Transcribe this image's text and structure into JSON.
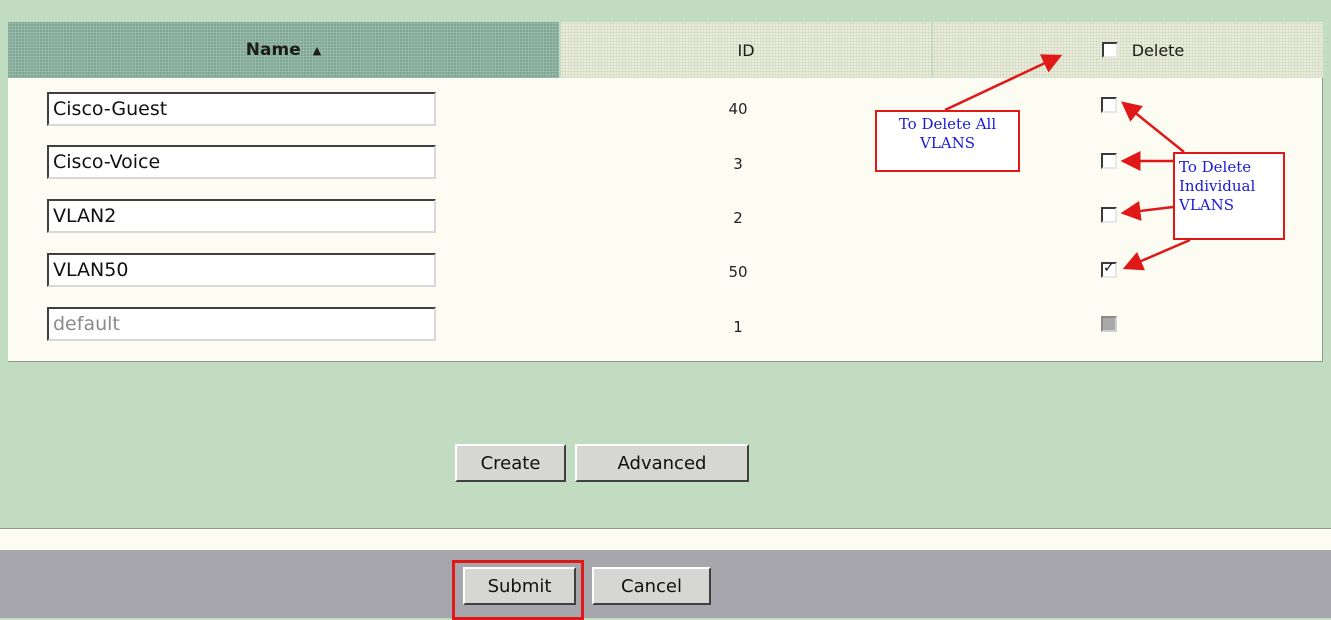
{
  "table": {
    "headers": {
      "name": "Name",
      "sort_indicator": "▲",
      "id": "ID",
      "delete": "Delete"
    },
    "rows": [
      {
        "name": "Cisco-Guest",
        "id": "40",
        "delete_checked": false,
        "editable": true
      },
      {
        "name": "Cisco-Voice",
        "id": "3",
        "delete_checked": false,
        "editable": true
      },
      {
        "name": "VLAN2",
        "id": "2",
        "delete_checked": false,
        "editable": true
      },
      {
        "name": "VLAN50",
        "id": "50",
        "delete_checked": true,
        "editable": true
      },
      {
        "name": "default",
        "id": "1",
        "delete_checked": false,
        "editable": false
      }
    ]
  },
  "buttons": {
    "create": "Create",
    "advanced": "Advanced",
    "submit": "Submit",
    "cancel": "Cancel"
  },
  "annotations": {
    "delete_all": [
      "To Delete All",
      "VLANS"
    ],
    "delete_individual": [
      "To Delete",
      "Individual",
      "VLANS"
    ]
  },
  "colors": {
    "page_bg": "#c2dcc2",
    "header_name_bg": "#7fa896",
    "panel_bg": "#fdfcf3",
    "annotation_red": "#e01818",
    "annotation_text": "#1a1ad8",
    "footer_gray": "#a7a6ac"
  }
}
